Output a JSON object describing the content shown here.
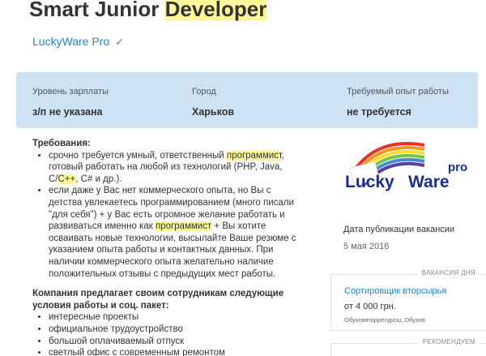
{
  "header": {
    "title_prefix": "Smart Junior ",
    "title_highlight": "Developer",
    "company": "LuckyWare Pro",
    "verified_mark": "✓"
  },
  "info": [
    {
      "label": "Уровень зарплаты",
      "value": "з/п не указана"
    },
    {
      "label": "Город",
      "value": "Харьков"
    },
    {
      "label": "Требуемый опыт работы",
      "value": "не требуется"
    }
  ],
  "description": {
    "requirements_title": "Требования:",
    "req1_a": "срочно требуется умный, ответственный ",
    "req1_hl": "программист",
    "req1_b": ", готовый работать на любой из технологий (PHP, Java, C/",
    "req1_hl2": "C++",
    "req1_c": ", C# и др.).",
    "req2_a": "если даже у Вас нет коммерческого опыта, но Вы с детства увлекаетесь программированием (много писали \"для себя\") + у Вас есть огромное желание работать и развиваться именно как ",
    "req2_hl": "программист",
    "req2_b": " + Вы хотите осваивать новые технологии, высылайте Ваше резюме с указанием опыта работы и контактных данных. При наличии коммерческого опыта желательно наличие положительных отзывы с предыдущих мест работы.",
    "offer_title": "Компания предлагает своим сотрудникам следующие условия работы и соц. пакет:",
    "offers": [
      "интересные проекты",
      "официальное трудоустройство",
      "большой оплачиваемый отпуск",
      "светлый офис с современным ремонтом"
    ]
  },
  "logo": {
    "word_lucky": "Lucky",
    "word_ware": "Ware",
    "word_pro": "pro"
  },
  "publication": {
    "label": "Дата публикации вакансии",
    "date": "5 мая 2016"
  },
  "day_vacancy": {
    "tag": "ВАКАНСИЯ ДНЯ",
    "title": "Сортировщик вторсырья",
    "salary": "от 4 000 грн.",
    "company": "Обуховвторресурсы, Обухов"
  },
  "recommended": {
    "tag": "РЕКОМЕНДУЕМ"
  },
  "colors": {
    "link": "#1e87d2",
    "highlight": "#fdf99a",
    "panel": "#cde3f4",
    "logo_blue": "#1a2f8f"
  }
}
